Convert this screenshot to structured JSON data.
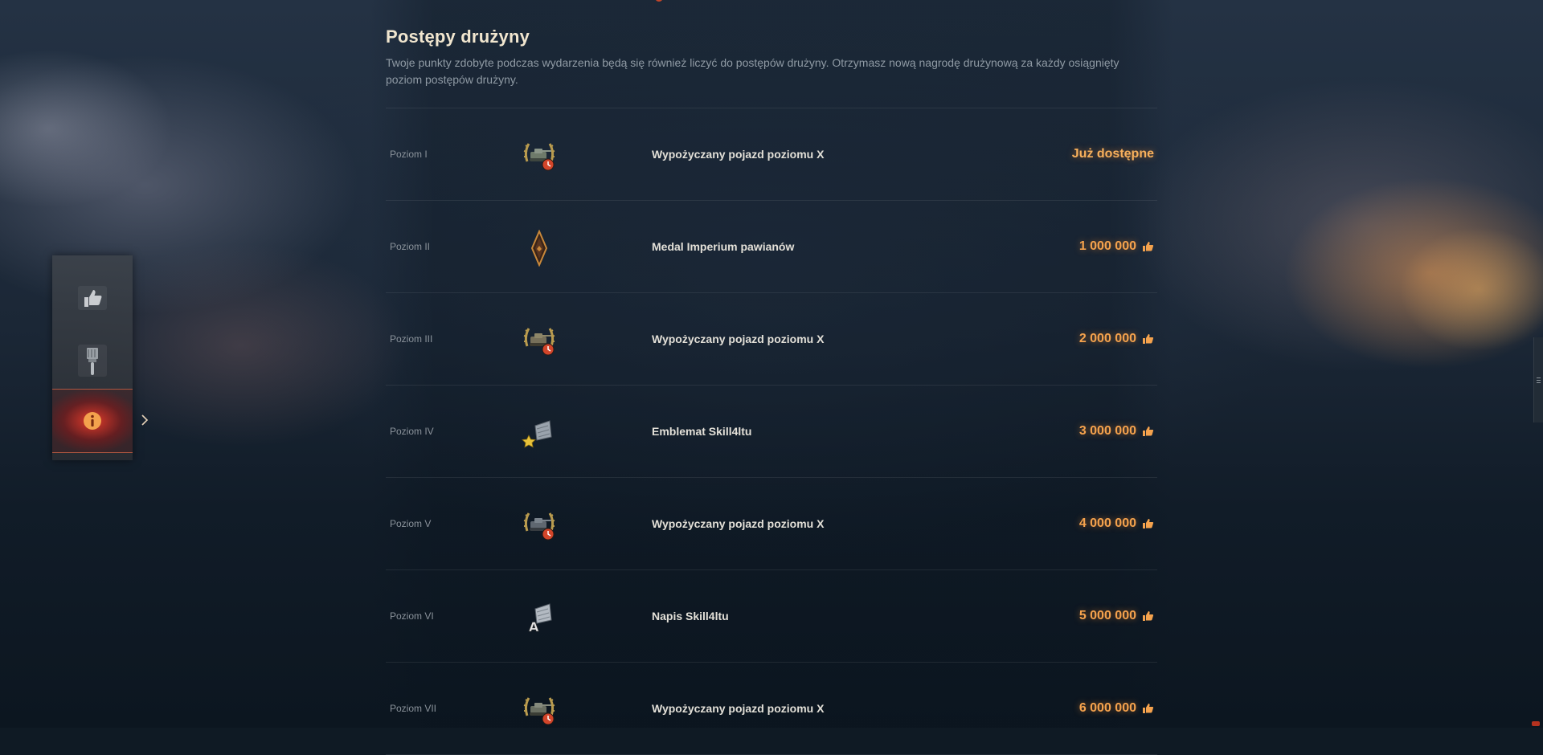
{
  "section": {
    "title": "Postępy drużyny",
    "description": "Twoje punkty zdobyte podczas wydarzenia będą się również liczyć do postępów drużyny. Otrzymasz nową nagrodę drużynową za każdy osiągnięty poziom postępów drużyny."
  },
  "levels": [
    {
      "level": "Poziom I",
      "icon": "rental-vehicle-icon",
      "reward": "Wypożyczany pojazd poziomu X",
      "requirement": "Już dostępne",
      "unlocked": true
    },
    {
      "level": "Poziom II",
      "icon": "medal-icon",
      "reward": "Medal Imperium pawianów",
      "requirement": "1 000 000",
      "unlocked": false
    },
    {
      "level": "Poziom III",
      "icon": "rental-vehicle-icon",
      "reward": "Wypożyczany pojazd poziomu X",
      "requirement": "2 000 000",
      "unlocked": false
    },
    {
      "level": "Poziom IV",
      "icon": "emblem-icon",
      "reward": "Emblemat Skill4ltu",
      "requirement": "3 000 000",
      "unlocked": false
    },
    {
      "level": "Poziom V",
      "icon": "rental-vehicle-icon",
      "reward": "Wypożyczany pojazd poziomu X",
      "requirement": "4 000 000",
      "unlocked": false
    },
    {
      "level": "Poziom VI",
      "icon": "inscription-icon",
      "reward": "Napis Skill4ltu",
      "requirement": "5 000 000",
      "unlocked": false
    },
    {
      "level": "Poziom VII",
      "icon": "rental-vehicle-icon",
      "reward": "Wypożyczany pojazd poziomu X",
      "requirement": "6 000 000",
      "unlocked": false
    }
  ],
  "sidebar": {
    "items": [
      {
        "icon": "thumbs-up-icon",
        "active": false
      },
      {
        "icon": "brush-icon",
        "active": false
      },
      {
        "icon": "info-icon",
        "active": true
      }
    ]
  },
  "colors": {
    "accent": "#f4a24d",
    "title": "#f1e6cf",
    "text": "#e3e0d8",
    "muted": "#8f9aa4",
    "active_tab": "#c8281e"
  }
}
